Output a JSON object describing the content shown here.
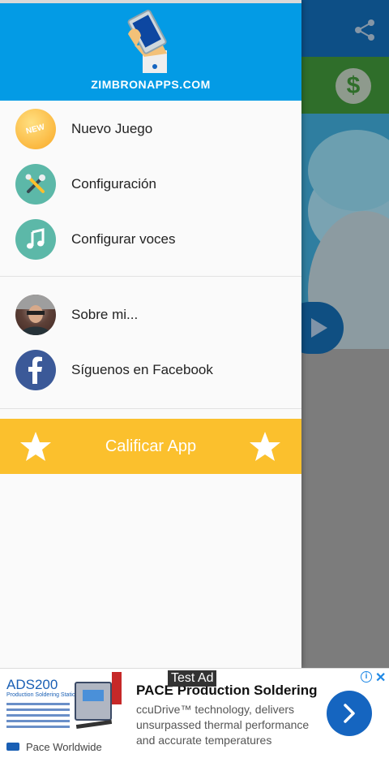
{
  "drawer": {
    "brand": "ZIMBRONAPPS.COM",
    "items": [
      {
        "label": "Nuevo Juego",
        "icon": "new-badge-icon"
      },
      {
        "label": "Configuración",
        "icon": "tools-icon"
      },
      {
        "label": "Configurar voces",
        "icon": "music-note-icon"
      },
      {
        "label": "Sobre mi...",
        "icon": "avatar"
      },
      {
        "label": "Síguenos en Facebook",
        "icon": "facebook-icon"
      }
    ],
    "new_badge": "NEW",
    "rate_label": "Calificar App"
  },
  "background": {
    "dollar_symbol": "$"
  },
  "ad": {
    "label": "Test Ad",
    "banner_title": "ADS200",
    "banner_subtitle": "Production Soldering Station",
    "advertiser": "Pace Worldwide",
    "title": "PACE Production Soldering",
    "description": "ccuDrive™ technology, delivers unsurpassed thermal performance and accurate temperatures",
    "info_symbol": "i",
    "close_symbol": "✕"
  },
  "colors": {
    "header": "#039be5",
    "rate_bar": "#fbc02d",
    "facebook": "#3b5998",
    "teal": "#5cb8a8"
  }
}
